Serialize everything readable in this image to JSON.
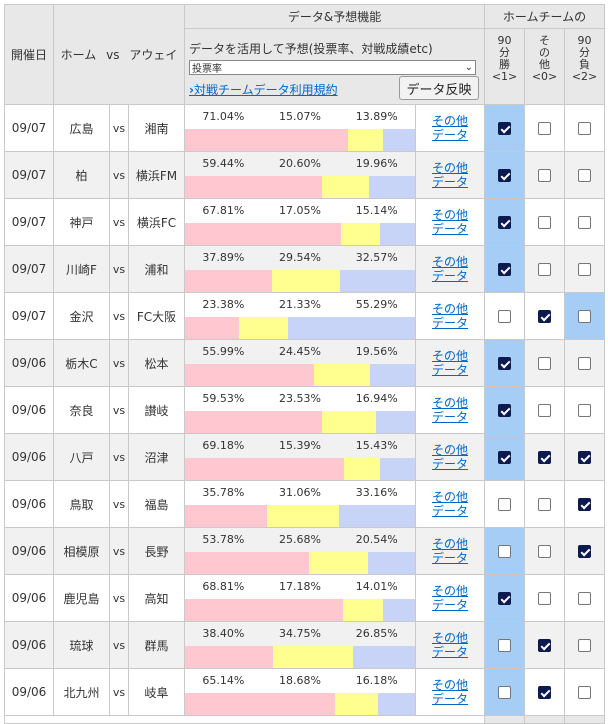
{
  "header": {
    "date_col": "開催日",
    "home_col": "ホーム",
    "vs_col": "vs",
    "away_col": "アウェイ",
    "predict_col": "データ&予想機能",
    "result_col": "ホームチームの",
    "predict_title": "データを活用して予想(投票率、対戦成績etc)",
    "predict_select_value": "投票率",
    "terms_link": "対戦チームデータ利用規約",
    "reflect_button": "データ反映",
    "win_label": [
      "90",
      "分",
      "勝",
      "<1>"
    ],
    "other_label": [
      "そ",
      "の",
      "他",
      "<0>"
    ],
    "lose_label": [
      "90",
      "分",
      "負",
      "<2>"
    ]
  },
  "other_data_label": [
    "その他",
    "データ"
  ],
  "colors": {
    "home_bar": "#ffc7cf",
    "draw_bar": "#ffff8f",
    "away_bar": "#c7d4f7",
    "selected": "#a5cdf5",
    "link": "#0067c7"
  },
  "matches": [
    {
      "date": "09/07",
      "home": "広島",
      "vs": "vs",
      "away": "湘南",
      "home_pct": "71.04%",
      "draw_pct": "15.07%",
      "away_pct": "13.89%",
      "home_v": 71.04,
      "draw_v": 15.07,
      "away_v": 13.89,
      "win": true,
      "other": false,
      "lose": false,
      "sel": [
        true,
        false,
        false
      ]
    },
    {
      "date": "09/07",
      "home": "柏",
      "vs": "vs",
      "away": "横浜FM",
      "home_pct": "59.44%",
      "draw_pct": "20.60%",
      "away_pct": "19.96%",
      "home_v": 59.44,
      "draw_v": 20.6,
      "away_v": 19.96,
      "win": true,
      "other": false,
      "lose": false,
      "sel": [
        true,
        false,
        false
      ]
    },
    {
      "date": "09/07",
      "home": "神戸",
      "vs": "vs",
      "away": "横浜FC",
      "home_pct": "67.81%",
      "draw_pct": "17.05%",
      "away_pct": "15.14%",
      "home_v": 67.81,
      "draw_v": 17.05,
      "away_v": 15.14,
      "win": true,
      "other": false,
      "lose": false,
      "sel": [
        true,
        false,
        false
      ]
    },
    {
      "date": "09/07",
      "home": "川崎F",
      "vs": "vs",
      "away": "浦和",
      "home_pct": "37.89%",
      "draw_pct": "29.54%",
      "away_pct": "32.57%",
      "home_v": 37.89,
      "draw_v": 29.54,
      "away_v": 32.57,
      "win": true,
      "other": false,
      "lose": false,
      "sel": [
        true,
        false,
        false
      ]
    },
    {
      "date": "09/07",
      "home": "金沢",
      "vs": "vs",
      "away": "FC大阪",
      "home_pct": "23.38%",
      "draw_pct": "21.33%",
      "away_pct": "55.29%",
      "home_v": 23.38,
      "draw_v": 21.33,
      "away_v": 55.29,
      "win": false,
      "other": true,
      "lose": false,
      "sel": [
        false,
        false,
        true
      ]
    },
    {
      "date": "09/06",
      "home": "栃木C",
      "vs": "vs",
      "away": "松本",
      "home_pct": "55.99%",
      "draw_pct": "24.45%",
      "away_pct": "19.56%",
      "home_v": 55.99,
      "draw_v": 24.45,
      "away_v": 19.56,
      "win": true,
      "other": false,
      "lose": false,
      "sel": [
        true,
        false,
        false
      ]
    },
    {
      "date": "09/06",
      "home": "奈良",
      "vs": "vs",
      "away": "讃岐",
      "home_pct": "59.53%",
      "draw_pct": "23.53%",
      "away_pct": "16.94%",
      "home_v": 59.53,
      "draw_v": 23.53,
      "away_v": 16.94,
      "win": true,
      "other": false,
      "lose": false,
      "sel": [
        true,
        false,
        false
      ]
    },
    {
      "date": "09/06",
      "home": "八戸",
      "vs": "vs",
      "away": "沼津",
      "home_pct": "69.18%",
      "draw_pct": "15.39%",
      "away_pct": "15.43%",
      "home_v": 69.18,
      "draw_v": 15.39,
      "away_v": 15.43,
      "win": true,
      "other": true,
      "lose": true,
      "sel": [
        true,
        false,
        false
      ]
    },
    {
      "date": "09/06",
      "home": "鳥取",
      "vs": "vs",
      "away": "福島",
      "home_pct": "35.78%",
      "draw_pct": "31.06%",
      "away_pct": "33.16%",
      "home_v": 35.78,
      "draw_v": 31.06,
      "away_v": 33.16,
      "win": false,
      "other": false,
      "lose": true,
      "sel": [
        false,
        false,
        false
      ]
    },
    {
      "date": "09/06",
      "home": "相模原",
      "vs": "vs",
      "away": "長野",
      "home_pct": "53.78%",
      "draw_pct": "25.68%",
      "away_pct": "20.54%",
      "home_v": 53.78,
      "draw_v": 25.68,
      "away_v": 20.54,
      "win": false,
      "other": false,
      "lose": true,
      "sel": [
        true,
        false,
        false
      ]
    },
    {
      "date": "09/06",
      "home": "鹿児島",
      "vs": "vs",
      "away": "高知",
      "home_pct": "68.81%",
      "draw_pct": "17.18%",
      "away_pct": "14.01%",
      "home_v": 68.81,
      "draw_v": 17.18,
      "away_v": 14.01,
      "win": true,
      "other": false,
      "lose": false,
      "sel": [
        true,
        false,
        false
      ]
    },
    {
      "date": "09/06",
      "home": "琉球",
      "vs": "vs",
      "away": "群馬",
      "home_pct": "38.40%",
      "draw_pct": "34.75%",
      "away_pct": "26.85%",
      "home_v": 38.4,
      "draw_v": 34.75,
      "away_v": 26.85,
      "win": false,
      "other": true,
      "lose": false,
      "sel": [
        true,
        false,
        false
      ]
    },
    {
      "date": "09/06",
      "home": "北九州",
      "vs": "vs",
      "away": "岐阜",
      "home_pct": "65.14%",
      "draw_pct": "18.68%",
      "away_pct": "16.18%",
      "home_v": 65.14,
      "draw_v": 18.68,
      "away_v": 16.18,
      "win": false,
      "other": true,
      "lose": false,
      "sel": [
        true,
        false,
        false
      ]
    }
  ]
}
